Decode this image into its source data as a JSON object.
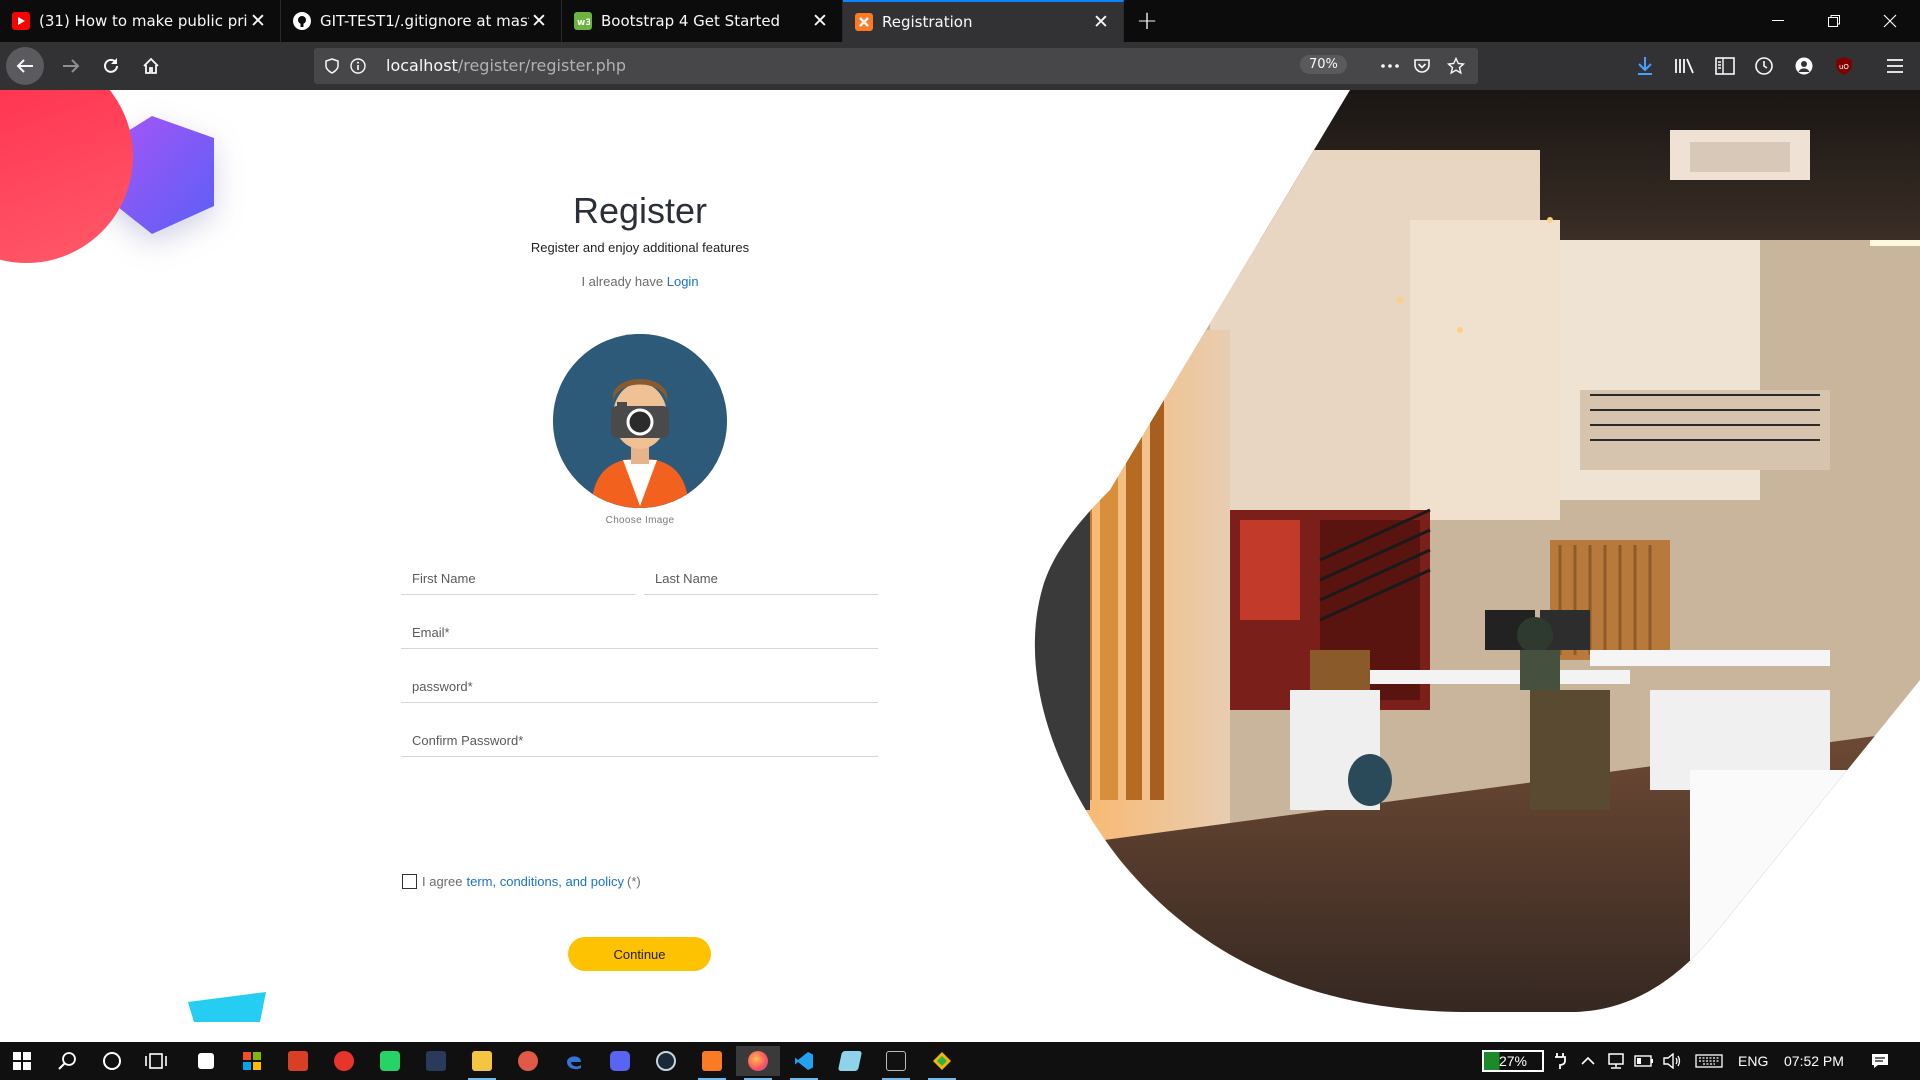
{
  "browser": {
    "tabs": [
      {
        "title": "(31) How to make public privat",
        "favicon_color": "#ff0000",
        "favicon_glyph": "▶",
        "active": false
      },
      {
        "title": "GIT-TEST1/.gitignore at master",
        "favicon_color": "#ffffff",
        "favicon_glyph": "",
        "active": false
      },
      {
        "title": "Bootstrap 4 Get Started",
        "favicon_color": "#6db33f",
        "favicon_glyph": "w3",
        "active": false
      },
      {
        "title": "Registration",
        "favicon_color": "#fb7a24",
        "favicon_glyph": "⌘",
        "active": true
      }
    ],
    "url_host": "localhost",
    "url_path": "/register/register.php",
    "zoom": "70%",
    "accent": "#0a84ff"
  },
  "register": {
    "title": "Register",
    "subtitle": "Register and enjoy additional features",
    "login_prompt": "I already have",
    "login_link": "Login",
    "choose_image": "Choose Image",
    "first_name_placeholder": "First Name",
    "last_name_placeholder": "Last Name",
    "email_placeholder": "Email*",
    "password_placeholder": "password*",
    "confirm_password_placeholder": "Confirm Password*",
    "agree_text": "I agree",
    "terms_link": "term, conditions, and policy",
    "required_mark": "(*)",
    "continue_label": "Continue",
    "button_color": "#fdc201",
    "link_color": "#1a73c7"
  },
  "taskbar": {
    "battery": "27%",
    "language": "ENG",
    "time": "07:52 PM"
  }
}
